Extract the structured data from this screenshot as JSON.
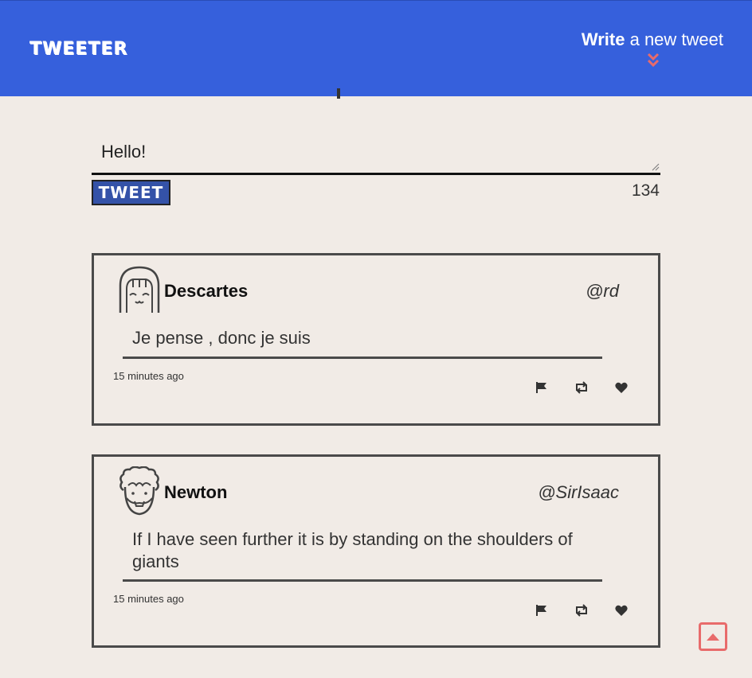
{
  "nav": {
    "brand": "TWEETER",
    "write_bold": "Write",
    "write_rest": " a new tweet"
  },
  "compose": {
    "value": "Hello!",
    "button_label": "TWEET",
    "counter": "134"
  },
  "tweets": [
    {
      "author": "Descartes",
      "handle": "@rd",
      "text": "Je pense , donc je suis",
      "time": "15 minutes ago",
      "avatar_icon": "girl-avatar-icon"
    },
    {
      "author": "Newton",
      "handle": "@SirIsaac",
      "text": "If I have seen further it is by standing on the shoulders of giants",
      "time": "15 minutes ago",
      "avatar_icon": "curly-hair-avatar-icon"
    }
  ],
  "colors": {
    "nav_bg": "#3660dc",
    "page_bg": "#f1ebe6",
    "accent": "#e86b6b",
    "button_bg": "#3452a8"
  }
}
